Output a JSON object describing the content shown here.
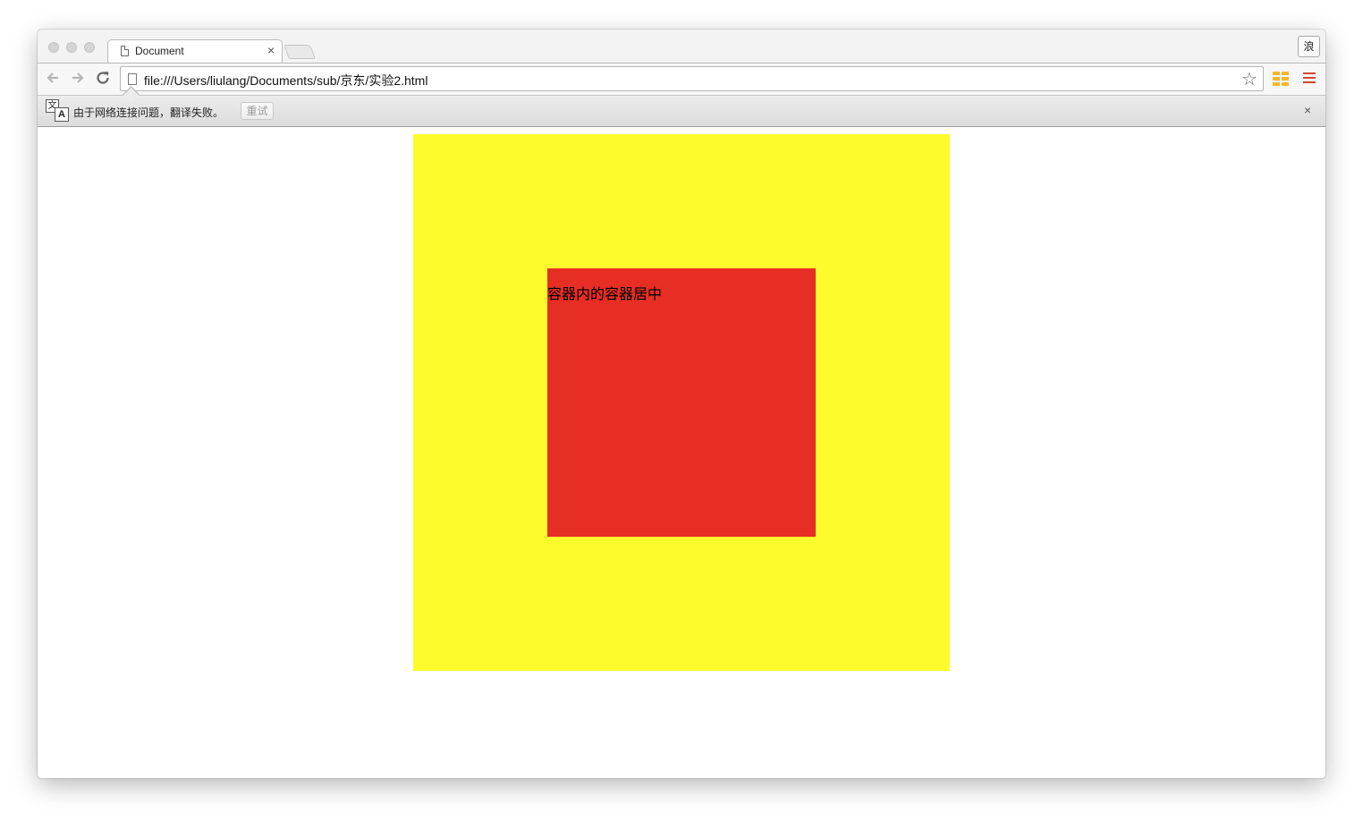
{
  "browser": {
    "tab": {
      "title": "Document",
      "close_glyph": "×"
    },
    "profile_label": "浪",
    "address_bar": {
      "url": "file:///Users/liulang/Documents/sub/京东/实验2.html"
    },
    "icons": {
      "back": "back-arrow-icon",
      "forward": "forward-arrow-icon",
      "reload": "reload-icon",
      "page": "page-icon",
      "star": "star-icon",
      "extension": "extension-icon",
      "menu": "menu-icon"
    }
  },
  "translate_bar": {
    "icon_back_glyph": "文",
    "icon_front_glyph": "A",
    "message": "由于网络连接问题，翻译失败。",
    "retry_label": "重试",
    "close_glyph": "×"
  },
  "page": {
    "outer_color": "#fefb2d",
    "inner_color": "#e72e25",
    "inner_text": "容器内的容器居中"
  }
}
